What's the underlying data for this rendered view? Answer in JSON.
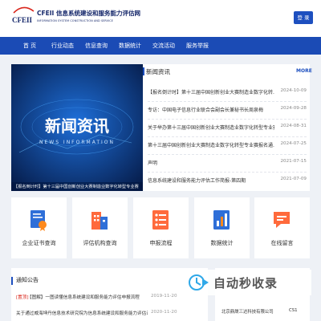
{
  "header": {
    "logo_title": "CFEII 信息系统建设和服务能力评估网",
    "logo_sub": "INFORMATION SYSTEM CONSTRUCTION AND SERVICE",
    "login_label": "登 录"
  },
  "nav": {
    "items": [
      "首 页",
      "行业动态",
      "信息查询",
      "数据统计",
      "交流活动",
      "服务举报"
    ]
  },
  "news": {
    "section_title": "新闻资讯",
    "more_label": "MORE",
    "image_title_big": "新闻资讯",
    "image_title_en": "NEWS INFORMATION",
    "image_caption": "【报名倒计时】第十三届中国创新创业大赛制造业数字化转型专业赛",
    "items": [
      {
        "title": "【报名倒计时】第十三届中国创新创业大赛制造业数字化转...",
        "date": "2024-10-09"
      },
      {
        "title": "专访：中国电子信息行业联合会副会长兼秘书长周泉梅",
        "date": "2024-09-28"
      },
      {
        "title": "关于举办第十三届中国创新创业大赛制造业数字化转型专业赛...",
        "date": "2024-08-31"
      },
      {
        "title": "第十三届中国创新创业大赛制造业数字化转型专业赛报名通...",
        "date": "2024-07-25"
      },
      {
        "title": "声明",
        "date": "2021-07-15"
      },
      {
        "title": "信息系统建设和服务能力评估工作简报-第四期",
        "date": "2021-07-09"
      }
    ]
  },
  "tiles": [
    {
      "label": "企业证书查询",
      "icon": "certificate-icon"
    },
    {
      "label": "评估机构查询",
      "icon": "building-icon"
    },
    {
      "label": "申报流程",
      "icon": "flow-icon"
    },
    {
      "label": "数据统计",
      "icon": "chart-icon"
    },
    {
      "label": "在线留言",
      "icon": "message-icon"
    }
  ],
  "notice": {
    "section_title": "通知公告",
    "items": [
      {
        "tag": "[置顶]",
        "title": "【图解】一图读懂信息系统建设和服务能力评估申报流程",
        "date": "2019-11-20"
      },
      {
        "tag": "",
        "title": "关于通过威海坤丹信息技术研究院为信息系统建设和服务能力评估试...",
        "date": "2020-11-20"
      }
    ]
  },
  "side": {
    "company": "北京鼎晟三达科技有限公司",
    "level": "CS1"
  },
  "watermark": {
    "text": "自动秒收录"
  },
  "colors": {
    "brand": "#1d4fbf",
    "nav": "#1b4bb5",
    "pin": "#d9261c"
  }
}
